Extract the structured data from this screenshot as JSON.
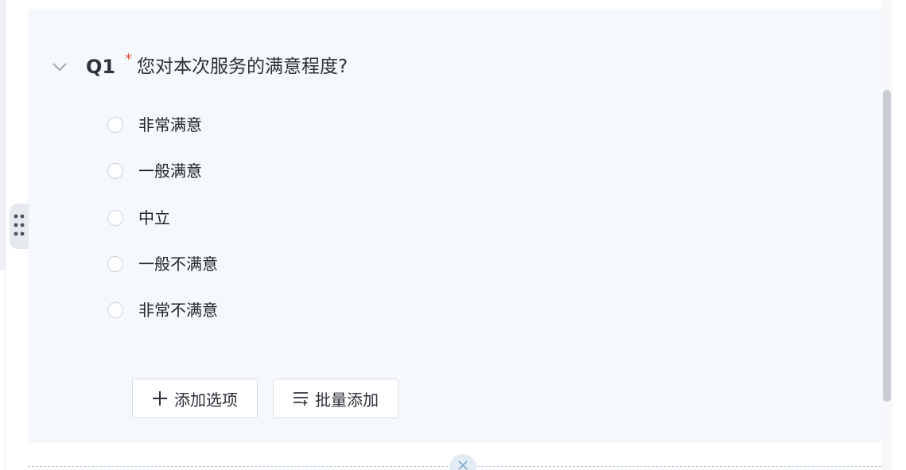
{
  "question": {
    "number": "Q1",
    "required_mark": "*",
    "title": "您对本次服务的满意程度?"
  },
  "options": [
    {
      "label": "非常满意"
    },
    {
      "label": "一般满意"
    },
    {
      "label": "中立"
    },
    {
      "label": "一般不满意"
    },
    {
      "label": "非常不满意"
    }
  ],
  "actions": {
    "add_option_label": "添加选项",
    "batch_add_label": "批量添加"
  },
  "icons": {
    "collapse": "chevron-down-icon",
    "drag": "drag-handle-icon",
    "add": "plus-icon",
    "batch": "list-add-icon",
    "insert": "insert-icon"
  },
  "colors": {
    "card_background": "#f5f9fd",
    "required": "#e8503a",
    "text": "#2b2f36"
  }
}
